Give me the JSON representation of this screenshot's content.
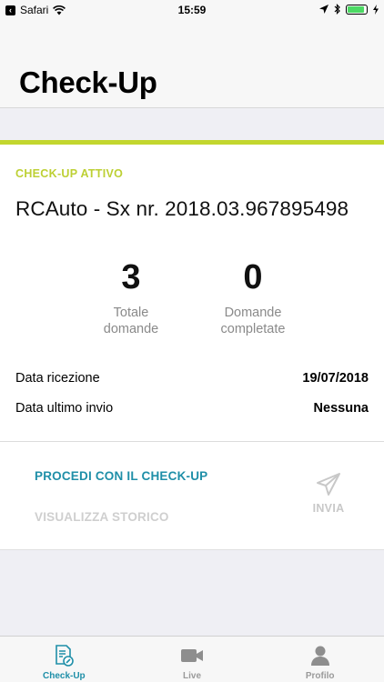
{
  "status_bar": {
    "back_app": "Safari",
    "time": "15:59",
    "battery_level": 0.9
  },
  "header": {
    "title": "Check-Up"
  },
  "card": {
    "active_label": "CHECK-UP ATTIVO",
    "claim_title": "RCAuto - Sx nr. 2018.03.967895498",
    "stats": {
      "total_value": "3",
      "total_label_line1": "Totale",
      "total_label_line2": "domande",
      "completed_value": "0",
      "completed_label_line1": "Domande",
      "completed_label_line2": "completate"
    },
    "info": {
      "received_label": "Data ricezione",
      "received_value": "19/07/2018",
      "last_sent_label": "Data ultimo invio",
      "last_sent_value": "Nessuna"
    },
    "actions": {
      "proceed": "PROCEDI CON IL CHECK-UP",
      "history": "VISUALIZZA STORICO",
      "send": "INVIA"
    }
  },
  "tabbar": {
    "tabs": [
      {
        "label": "Check-Up",
        "icon": "checklist-icon",
        "active": true
      },
      {
        "label": "Live",
        "icon": "video-camera-icon",
        "active": false
      },
      {
        "label": "Profilo",
        "icon": "person-icon",
        "active": false
      }
    ]
  },
  "colors": {
    "accent_green": "#c2d62e",
    "accent_blue": "#1f8fa8",
    "disabled_gray": "#cfcfcf"
  }
}
